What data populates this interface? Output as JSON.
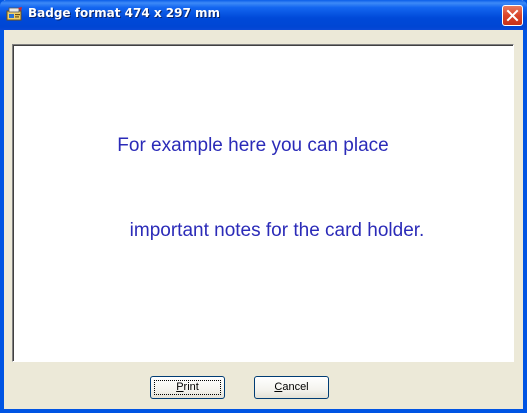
{
  "window": {
    "title": "Badge format 474 x 297 mm",
    "title_icon": "badge-app-icon",
    "close_icon": "close-icon",
    "accent_color": "#0054e3",
    "close_color": "#d9442a"
  },
  "canvas": {
    "line1": "For example here you can place",
    "line2": "important notes for the card holder.",
    "text_color": "#2b2bb8"
  },
  "buttons": {
    "print": {
      "label_first": "P",
      "label_rest": "rint"
    },
    "cancel": {
      "label_first": "C",
      "label_rest": "ancel"
    }
  }
}
